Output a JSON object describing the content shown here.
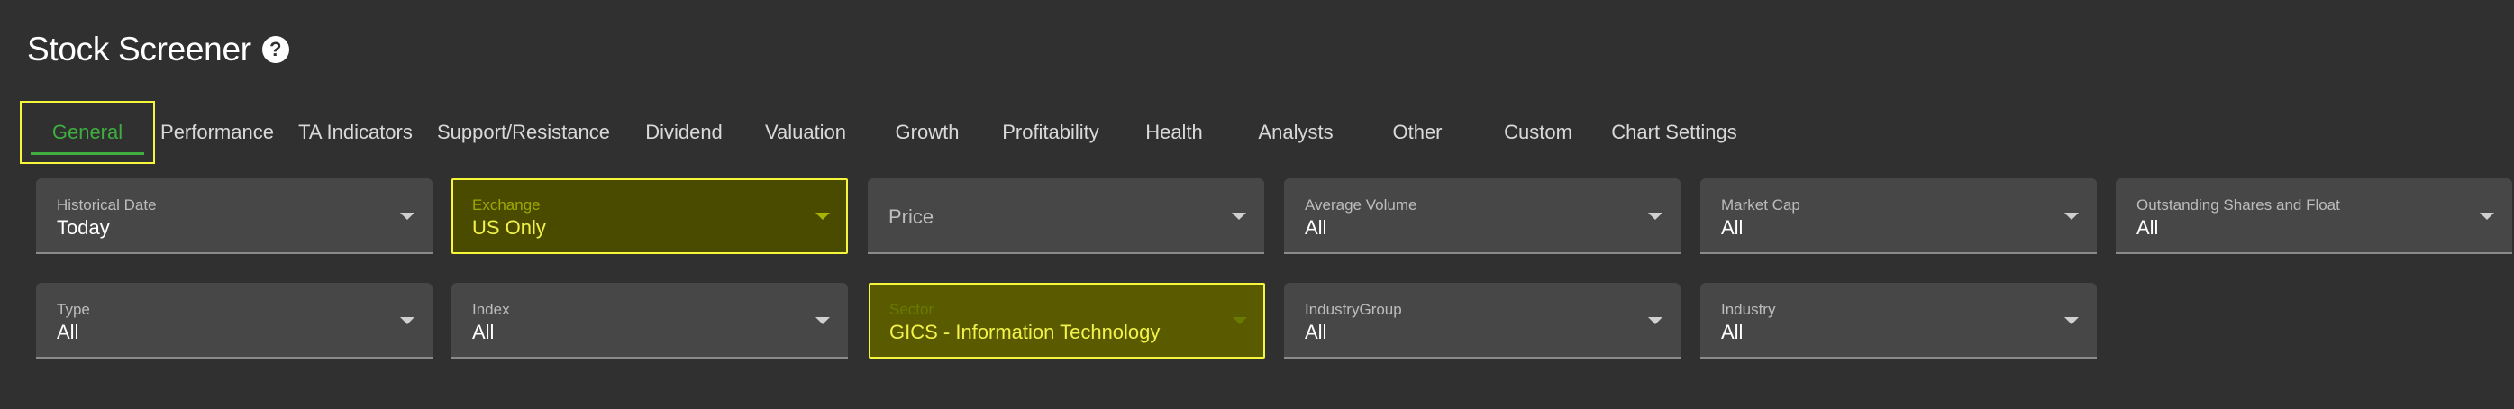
{
  "header": {
    "title": "Stock Screener",
    "help_icon": "?"
  },
  "tabs": [
    {
      "label": "General",
      "active": true
    },
    {
      "label": "Performance"
    },
    {
      "label": "TA Indicators"
    },
    {
      "label": "Support/Resistance"
    },
    {
      "label": "Dividend"
    },
    {
      "label": "Valuation"
    },
    {
      "label": "Growth"
    },
    {
      "label": "Profitability"
    },
    {
      "label": "Health"
    },
    {
      "label": "Analysts"
    },
    {
      "label": "Other"
    },
    {
      "label": "Custom"
    },
    {
      "label": "Chart Settings"
    }
  ],
  "filters_row1": [
    {
      "label": "Historical Date",
      "value": "Today"
    },
    {
      "label": "Exchange",
      "value": "US Only"
    },
    {
      "placeholder": "Price"
    },
    {
      "label": "Average Volume",
      "value": "All"
    },
    {
      "label": "Market Cap",
      "value": "All"
    },
    {
      "label": "Outstanding Shares and Float",
      "value": "All"
    }
  ],
  "filters_row2": [
    {
      "label": "Type",
      "value": "All"
    },
    {
      "label": "Index",
      "value": "All"
    },
    {
      "label": "Sector",
      "value": "GICS - Information Technology"
    },
    {
      "label": "IndustryGroup",
      "value": "All"
    },
    {
      "label": "Industry",
      "value": "All"
    }
  ],
  "colors": {
    "background": "#303030",
    "field_background": "#474747",
    "active_tab": "#3fae3f",
    "highlight_border": "#f6f63a",
    "highlight_fill": "#4b4b00"
  }
}
